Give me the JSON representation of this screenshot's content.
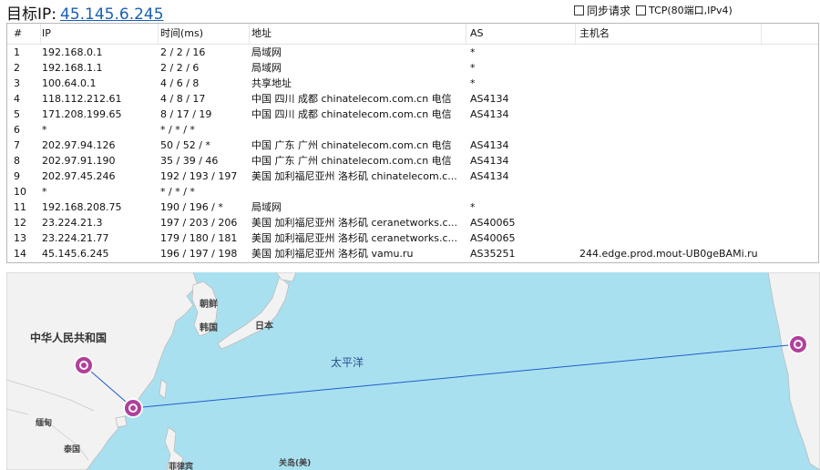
{
  "header": {
    "target_label": "目标IP:",
    "target_ip": "45.145.6.245",
    "option_sync": "同步请求",
    "option_tcp": "TCP(80端口,IPv4)"
  },
  "table": {
    "columns": [
      "#",
      "IP",
      "时间(ms)",
      "地址",
      "AS",
      "主机名"
    ],
    "rows": [
      [
        "1",
        "192.168.0.1",
        "2 / 2 / 16",
        "局域网",
        "*",
        ""
      ],
      [
        "2",
        "192.168.1.1",
        "2 / 2 / 6",
        "局域网",
        "*",
        ""
      ],
      [
        "3",
        "100.64.0.1",
        "4 / 6 / 8",
        "共享地址",
        "*",
        ""
      ],
      [
        "4",
        "118.112.212.61",
        "4 / 8 / 17",
        "中国 四川 成都 chinatelecom.com.cn 电信",
        "AS4134",
        ""
      ],
      [
        "5",
        "171.208.199.65",
        "8 / 17 / 19",
        "中国 四川 成都 chinatelecom.com.cn 电信",
        "AS4134",
        ""
      ],
      [
        "6",
        "*",
        "* / * / *",
        "",
        "",
        ""
      ],
      [
        "7",
        "202.97.94.126",
        "50 / 52 / *",
        "中国 广东 广州 chinatelecom.com.cn 电信",
        "AS4134",
        ""
      ],
      [
        "8",
        "202.97.91.190",
        "35 / 39 / 46",
        "中国 广东 广州 chinatelecom.com.cn 电信",
        "AS4134",
        ""
      ],
      [
        "9",
        "202.97.45.246",
        "192 / 193 / 197",
        "美国 加利福尼亚州 洛杉矶 chinatelecom.c...",
        "AS4134",
        ""
      ],
      [
        "10",
        "*",
        "* / * / *",
        "",
        "",
        ""
      ],
      [
        "11",
        "192.168.208.75",
        "190 / 196 / *",
        "局域网",
        "*",
        ""
      ],
      [
        "12",
        "23.224.21.3",
        "197 / 203 / 206",
        "美国 加利福尼亚州 洛杉矶 ceranetworks.c...",
        "AS40065",
        ""
      ],
      [
        "13",
        "23.224.21.77",
        "179 / 180 / 181",
        "美国 加利福尼亚州 洛杉矶 ceranetworks.c...",
        "AS40065",
        ""
      ],
      [
        "14",
        "45.145.6.245",
        "196 / 197 / 198",
        "美国 加利福尼亚州 洛杉矶 vamu.ru",
        "AS35251",
        "244.edge.prod.mout-UB0geBAMi.ru"
      ]
    ]
  },
  "map": {
    "labels": {
      "china": "中华人民共和国",
      "north_korea": "朝鲜",
      "south_korea": "韩国",
      "japan": "日本",
      "pacific": "太平洋",
      "myanmar": "缅甸",
      "thailand": "泰国",
      "philippines": "菲律宾",
      "guam": "关岛(美)"
    },
    "colors": {
      "ocean": "#a8e0f0",
      "land": "#f2f2f2",
      "route": "#1f5fcc",
      "marker": "#b0409a"
    }
  }
}
